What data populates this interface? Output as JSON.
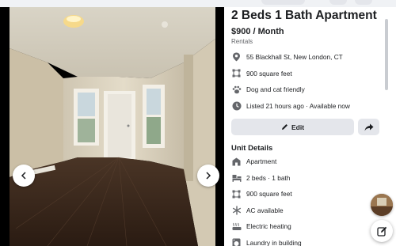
{
  "listing": {
    "title": "2 Beds 1 Bath Apartment",
    "price": "$900 / Month",
    "category": "Rentals",
    "info": [
      {
        "icon": "map-pin-icon",
        "text": "55 Blackhall St, New London, CT"
      },
      {
        "icon": "square-feet-icon",
        "text": "900 square feet"
      },
      {
        "icon": "paw-icon",
        "text": "Dog and cat friendly"
      },
      {
        "icon": "clock-icon",
        "text": "Listed 21 hours ago · Available now"
      }
    ],
    "edit_label": "Edit",
    "share_icon": "share-arrow-icon"
  },
  "unit_details": {
    "title": "Unit Details",
    "items": [
      {
        "icon": "building-icon",
        "text": "Apartment"
      },
      {
        "icon": "bed-icon",
        "text": "2 beds · 1 bath"
      },
      {
        "icon": "square-feet-icon",
        "text": "900 square feet"
      },
      {
        "icon": "snowflake-icon",
        "text": "AC available"
      },
      {
        "icon": "heater-icon",
        "text": "Electric heating"
      },
      {
        "icon": "laundry-icon",
        "text": "Laundry in building"
      }
    ]
  },
  "photo": {
    "prev_icon": "chevron-left-icon",
    "next_icon": "chevron-right-icon"
  },
  "colors": {
    "accent": "#1c1e21",
    "button_bg": "#e4e6eb",
    "secondary_text": "#65676b",
    "icon": "#65676b"
  }
}
